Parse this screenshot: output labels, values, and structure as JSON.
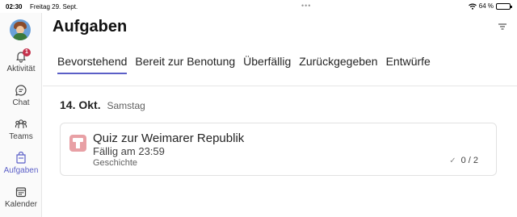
{
  "status_bar": {
    "time": "02:30",
    "date": "Freitag 29. Sept.",
    "dots": "•••",
    "battery": "64 %",
    "battery_level": 0.64
  },
  "rail": {
    "items": [
      {
        "label": "Aktivität",
        "icon": "bell-icon",
        "badge": "1"
      },
      {
        "label": "Chat",
        "icon": "chat-icon"
      },
      {
        "label": "Teams",
        "icon": "teams-icon"
      },
      {
        "label": "Aufgaben",
        "icon": "assignments-icon",
        "active": true
      },
      {
        "label": "Kalender",
        "icon": "calendar-icon"
      }
    ]
  },
  "header": {
    "title": "Aufgaben"
  },
  "tabs": [
    {
      "label": "Bevorstehend",
      "active": true
    },
    {
      "label": "Bereit zur Benotung"
    },
    {
      "label": "Überfällig"
    },
    {
      "label": "Zurückgegeben"
    },
    {
      "label": "Entwürfe"
    }
  ],
  "section": {
    "day": "14. Okt.",
    "weekday": "Samstag"
  },
  "assignment": {
    "title": "Quiz zur Weimarer Republik",
    "due": "Fällig am 23:59",
    "class": "Geschichte",
    "check": "✓",
    "score": "0 / 2"
  },
  "colors": {
    "accent": "#5b5fc7",
    "badge": "#c4314b",
    "assignment_icon": "#e8a0a5"
  }
}
